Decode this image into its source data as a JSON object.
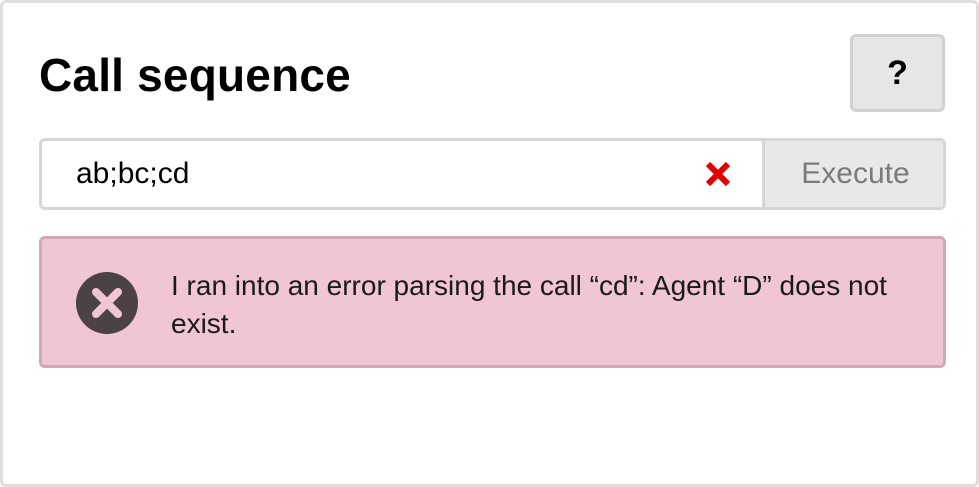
{
  "panel": {
    "title": "Call sequence",
    "help_label": "?"
  },
  "call_input": {
    "value": "ab;bc;cd",
    "clear_icon": "close-icon",
    "execute_label": "Execute"
  },
  "error": {
    "icon": "error-circle-icon",
    "message": "I ran into an error parsing the call “cd”: Agent “D” does not exist."
  },
  "colors": {
    "error_background": "#f0c5d4",
    "error_border": "#d0a8b6",
    "clear_icon": "#e00000",
    "error_icon": "#4a4246"
  }
}
